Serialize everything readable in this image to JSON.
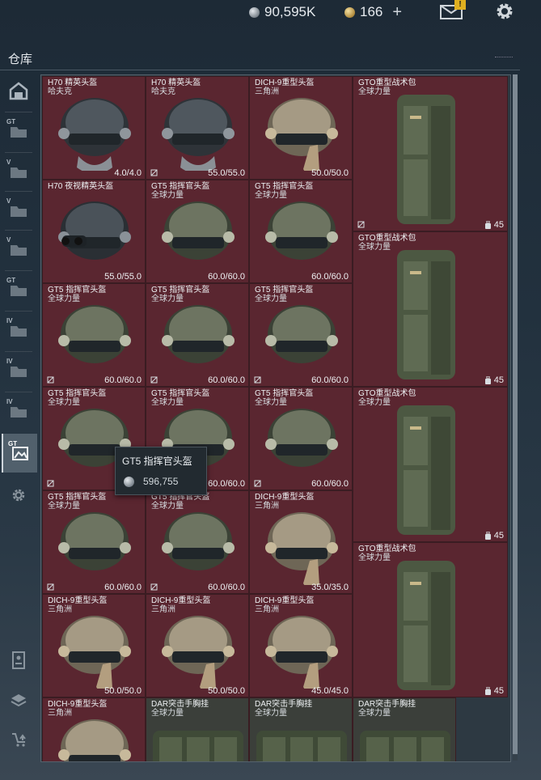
{
  "header": {
    "silver_amount": "90,595K",
    "gold_amount": "166",
    "plus_label": "+",
    "mail_badge": "!"
  },
  "section": {
    "title": "仓库"
  },
  "sidebar": {
    "items": [
      {
        "name": "all",
        "label": ""
      },
      {
        "name": "gt",
        "label": "GT"
      },
      {
        "name": "v1",
        "label": "V"
      },
      {
        "name": "v2",
        "label": "V"
      },
      {
        "name": "v3",
        "label": "V"
      },
      {
        "name": "gt2",
        "label": "GT"
      },
      {
        "name": "iv1",
        "label": "IV"
      },
      {
        "name": "iv2",
        "label": "IV"
      },
      {
        "name": "iv3",
        "label": "IV"
      },
      {
        "name": "gt-active",
        "label": "GT"
      }
    ]
  },
  "items": [
    {
      "name": "H70 精英头盔",
      "sub": "哈夫克",
      "dur": "4.0/4.0",
      "art": "helmet-black",
      "lock": false
    },
    {
      "name": "H70 精英头盔",
      "sub": "哈夫克",
      "dur": "55.0/55.0",
      "art": "helmet-black",
      "lock": true
    },
    {
      "name": "DICH-9重型头盔",
      "sub": "三角洲",
      "dur": "50.0/50.0",
      "art": "helmet-tan",
      "lock": false
    },
    {
      "name": "H70 夜视精英头盔",
      "sub": "",
      "dur": "55.0/55.0",
      "art": "helmet-nv",
      "lock": false
    },
    {
      "name": "GT5 指挥官头盔",
      "sub": "全球力量",
      "dur": "60.0/60.0",
      "art": "helmet-green",
      "lock": false
    },
    {
      "name": "GT5 指挥官头盔",
      "sub": "全球力量",
      "dur": "60.0/60.0",
      "art": "helmet-green",
      "lock": false
    },
    {
      "name": "GT5 指挥官头盔",
      "sub": "全球力量",
      "dur": "60.0/60.0",
      "art": "helmet-green",
      "lock": true
    },
    {
      "name": "GT5 指挥官头盔",
      "sub": "全球力量",
      "dur": "60.0/60.0",
      "art": "helmet-green",
      "lock": true
    },
    {
      "name": "GT5 指挥官头盔",
      "sub": "全球力量",
      "dur": "60.0/60.0",
      "art": "helmet-green",
      "lock": true
    },
    {
      "name": "GT5 指挥官头盔",
      "sub": "全球力量",
      "dur": "60.0",
      "art": "helmet-green",
      "lock": true
    },
    {
      "name": "GT5 指挥官头盔",
      "sub": "全球力量",
      "dur": "60.0/60.0",
      "art": "helmet-green",
      "lock": false
    },
    {
      "name": "GT5 指挥官头盔",
      "sub": "全球力量",
      "dur": "60.0/60.0",
      "art": "helmet-green",
      "lock": true
    },
    {
      "name": "GT5 指挥官头盔",
      "sub": "全球力量",
      "dur": "60.0/60.0",
      "art": "helmet-green",
      "lock": true
    },
    {
      "name": "GT5 指挥官头盔",
      "sub": "全球力量",
      "dur": "60.0/60.0",
      "art": "helmet-green",
      "lock": true
    },
    {
      "name": "DICH-9重型头盔",
      "sub": "三角洲",
      "dur": "35.0/35.0",
      "art": "helmet-tan",
      "lock": false
    },
    {
      "name": "DICH-9重型头盔",
      "sub": "三角洲",
      "dur": "50.0/50.0",
      "art": "helmet-tan",
      "lock": false
    },
    {
      "name": "DICH-9重型头盔",
      "sub": "三角洲",
      "dur": "50.0/50.0",
      "art": "helmet-tan",
      "lock": false
    },
    {
      "name": "DICH-9重型头盔",
      "sub": "三角洲",
      "dur": "45.0/45.0",
      "art": "helmet-tan",
      "lock": false
    },
    {
      "name": "DICH-9重型头盔",
      "sub": "三角洲",
      "dur": "",
      "art": "helmet-tan",
      "lock": false
    },
    {
      "name": "DAR突击手胸挂",
      "sub": "全球力量",
      "dur": "",
      "art": "rig",
      "lock": false
    },
    {
      "name": "DAR突击手胸挂",
      "sub": "全球力量",
      "dur": "",
      "art": "rig",
      "lock": false
    },
    {
      "name": "DAR突击手胸挂",
      "sub": "全球力量",
      "dur": "",
      "art": "rig",
      "lock": false
    }
  ],
  "backpacks": [
    {
      "name": "GTO重型战术包",
      "sub": "全球力量",
      "count": "45",
      "lock": true
    },
    {
      "name": "GTO重型战术包",
      "sub": "全球力量",
      "count": "45",
      "lock": false
    },
    {
      "name": "GTO重型战术包",
      "sub": "全球力量",
      "count": "45",
      "lock": false
    },
    {
      "name": "GTO重型战术包",
      "sub": "全球力量",
      "count": "45",
      "lock": false
    }
  ],
  "tooltip": {
    "name": "GT5 指挥官头盔",
    "price": "596,755"
  },
  "colors": {
    "cell_red": "#5a2630",
    "cell_dark": "#3b3f3a",
    "background": "#22313e"
  }
}
